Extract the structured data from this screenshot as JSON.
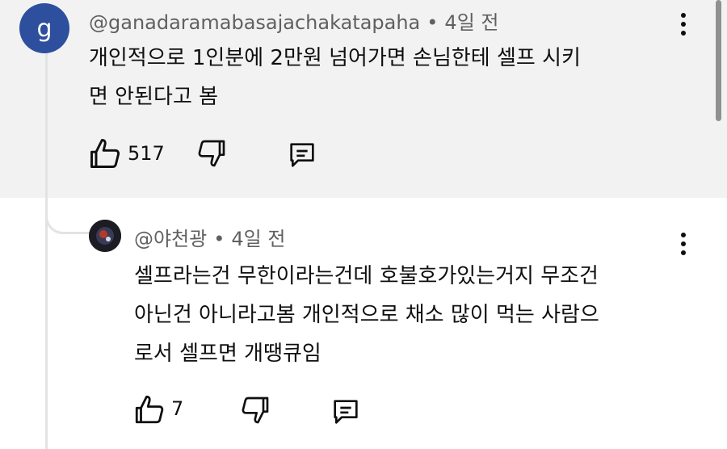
{
  "comment": {
    "avatar_letter": "g",
    "author": "@ganadaramabasajachakatapaha",
    "separator": "•",
    "time": "4일 전",
    "text_line1": "개인적으로 1인분에 2만원 넘어가면 손님한테 셀프 시키",
    "text_line2": "면 안된다고 봄",
    "like_count": "517",
    "icons": {
      "like": "thumbs-up-icon",
      "dislike": "thumbs-down-icon",
      "reply": "reply-icon",
      "more": "more-vert-icon"
    }
  },
  "reply": {
    "author": "@야천광",
    "separator": "•",
    "time": "4일 전",
    "text_line1": "셀프라는건 무한이라는건데 호불호가있는거지 무조건",
    "text_line2": "아닌건 아니라고봄 개인적으로 채소 많이 먹는 사람으",
    "text_line3": "로서 셀프면 개땡큐임",
    "like_count": "7",
    "icons": {
      "like": "thumbs-up-icon",
      "dislike": "thumbs-down-icon",
      "reply": "reply-icon",
      "more": "more-vert-icon"
    }
  },
  "colors": {
    "highlight_bg": "#f2f2f2",
    "avatar_bg": "#2d4f9e",
    "meta_text": "#606060"
  }
}
